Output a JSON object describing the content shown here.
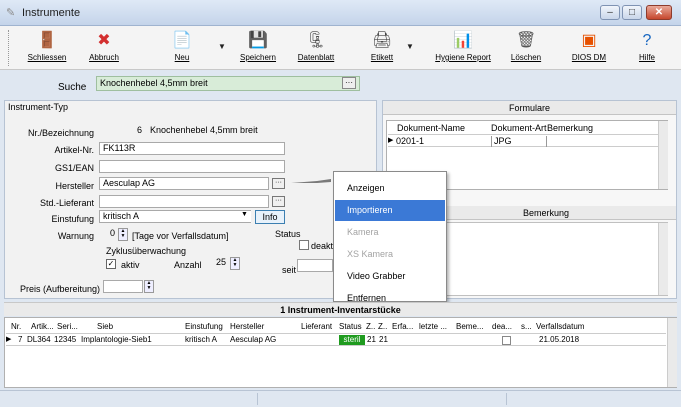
{
  "window": {
    "title": "Instrumente",
    "min": "–",
    "max": "□",
    "close": "✕"
  },
  "toolbar": [
    {
      "label": "Schliessen",
      "icon": "exit-icon",
      "glyph": "🚪",
      "color": "#b5651d"
    },
    {
      "label": "Abbruch",
      "icon": "cancel-icon",
      "glyph": "✖",
      "color": "#d32f2f"
    },
    {
      "label": "Neu",
      "icon": "new-document-icon",
      "glyph": "📄",
      "color": "#555"
    },
    {
      "label": "Speichern",
      "icon": "save-icon",
      "glyph": "💾",
      "color": "#2e7d32"
    },
    {
      "label": "Datenblatt",
      "icon": "datasheet-icon",
      "glyph": "🗜",
      "color": "#444"
    },
    {
      "label": "Etikett",
      "icon": "label-printer-icon",
      "glyph": "🖨",
      "color": "#444"
    },
    {
      "label": "Hygiene Report",
      "icon": "hygiene-report-icon",
      "glyph": "📊",
      "color": "#1565c0"
    },
    {
      "label": "Löschen",
      "icon": "delete-bin-icon",
      "glyph": "🗑",
      "color": "#555"
    },
    {
      "label": "DIOS DM",
      "icon": "dios-dm-icon",
      "glyph": "▣",
      "color": "#e65100"
    },
    {
      "label": "Hilfe",
      "icon": "help-icon",
      "glyph": "?",
      "color": "#1565c0"
    }
  ],
  "search": {
    "label": "Suche",
    "value": "Knochenhebel 4,5mm breit",
    "button": "···"
  },
  "form": {
    "section_title": "Instrument-Typ",
    "nr_label": "Nr./Bezeichnung",
    "nr": "6",
    "bezeichnung": "Knochenhebel 4,5mm breit",
    "artikel_label": "Artikel-Nr.",
    "artikel": "FK113R",
    "gs1_label": "GS1/EAN",
    "gs1": "",
    "hersteller_label": "Hersteller",
    "hersteller": "Aesculap AG",
    "std_label": "Std.-Lieferant",
    "std": "",
    "einstufung_label": "Einstufung",
    "einstufung": "kritisch A",
    "info_button": "Info",
    "warnung_label": "Warnung",
    "warnung_value": "0",
    "warnung_unit": "[Tage vor Verfallsdatum]",
    "zyklus_label": "Zyklusüberwachung",
    "aktiv_label": "aktiv",
    "anzahl_label": "Anzahl",
    "anzahl": "25",
    "status_label": "Status",
    "deakt_label": "deaktiv",
    "seit_label": "seit",
    "preis_label": "Preis (Aufbereitung)",
    "preis": ""
  },
  "formulare": {
    "title": "Formulare",
    "columns": [
      "Dokument-Name",
      "Dokument-Art",
      "Bemerkung"
    ],
    "rows": [
      [
        "0201-1",
        "JPG",
        ""
      ]
    ],
    "bemerkung_title": "Bemerkung"
  },
  "context_menu": {
    "items": [
      {
        "label": "Anzeigen",
        "state": "normal"
      },
      {
        "label": "Importieren",
        "state": "highlighted"
      },
      {
        "label": "Kamera",
        "state": "disabled"
      },
      {
        "label": "XS Kamera",
        "state": "disabled"
      },
      {
        "label": "Video Grabber",
        "state": "normal"
      },
      {
        "label": "Entfernen",
        "state": "normal"
      }
    ]
  },
  "inventory": {
    "title": "1 Instrument-Inventarstücke",
    "columns": [
      "Nr.",
      "Artik...",
      "Seri...",
      "Sieb",
      "Einstufung",
      "Hersteller",
      "Lieferant",
      "Status",
      "Z..",
      "Z..",
      "Erfa...",
      "letzte ...",
      "Beme...",
      "dea...",
      "s...",
      "Verfallsdatum"
    ],
    "rows": [
      {
        "nr": "7",
        "artikel": "DL364",
        "serie": "12345",
        "sieb": "Implantologie-Sieb1",
        "einstufung": "kritisch A",
        "hersteller": "Aesculap AG",
        "lieferant": "",
        "status": "steril",
        "z1": "21",
        "z2": "21",
        "verfall": "21.05.2018"
      }
    ],
    "status_color": "#1f9b1f"
  }
}
